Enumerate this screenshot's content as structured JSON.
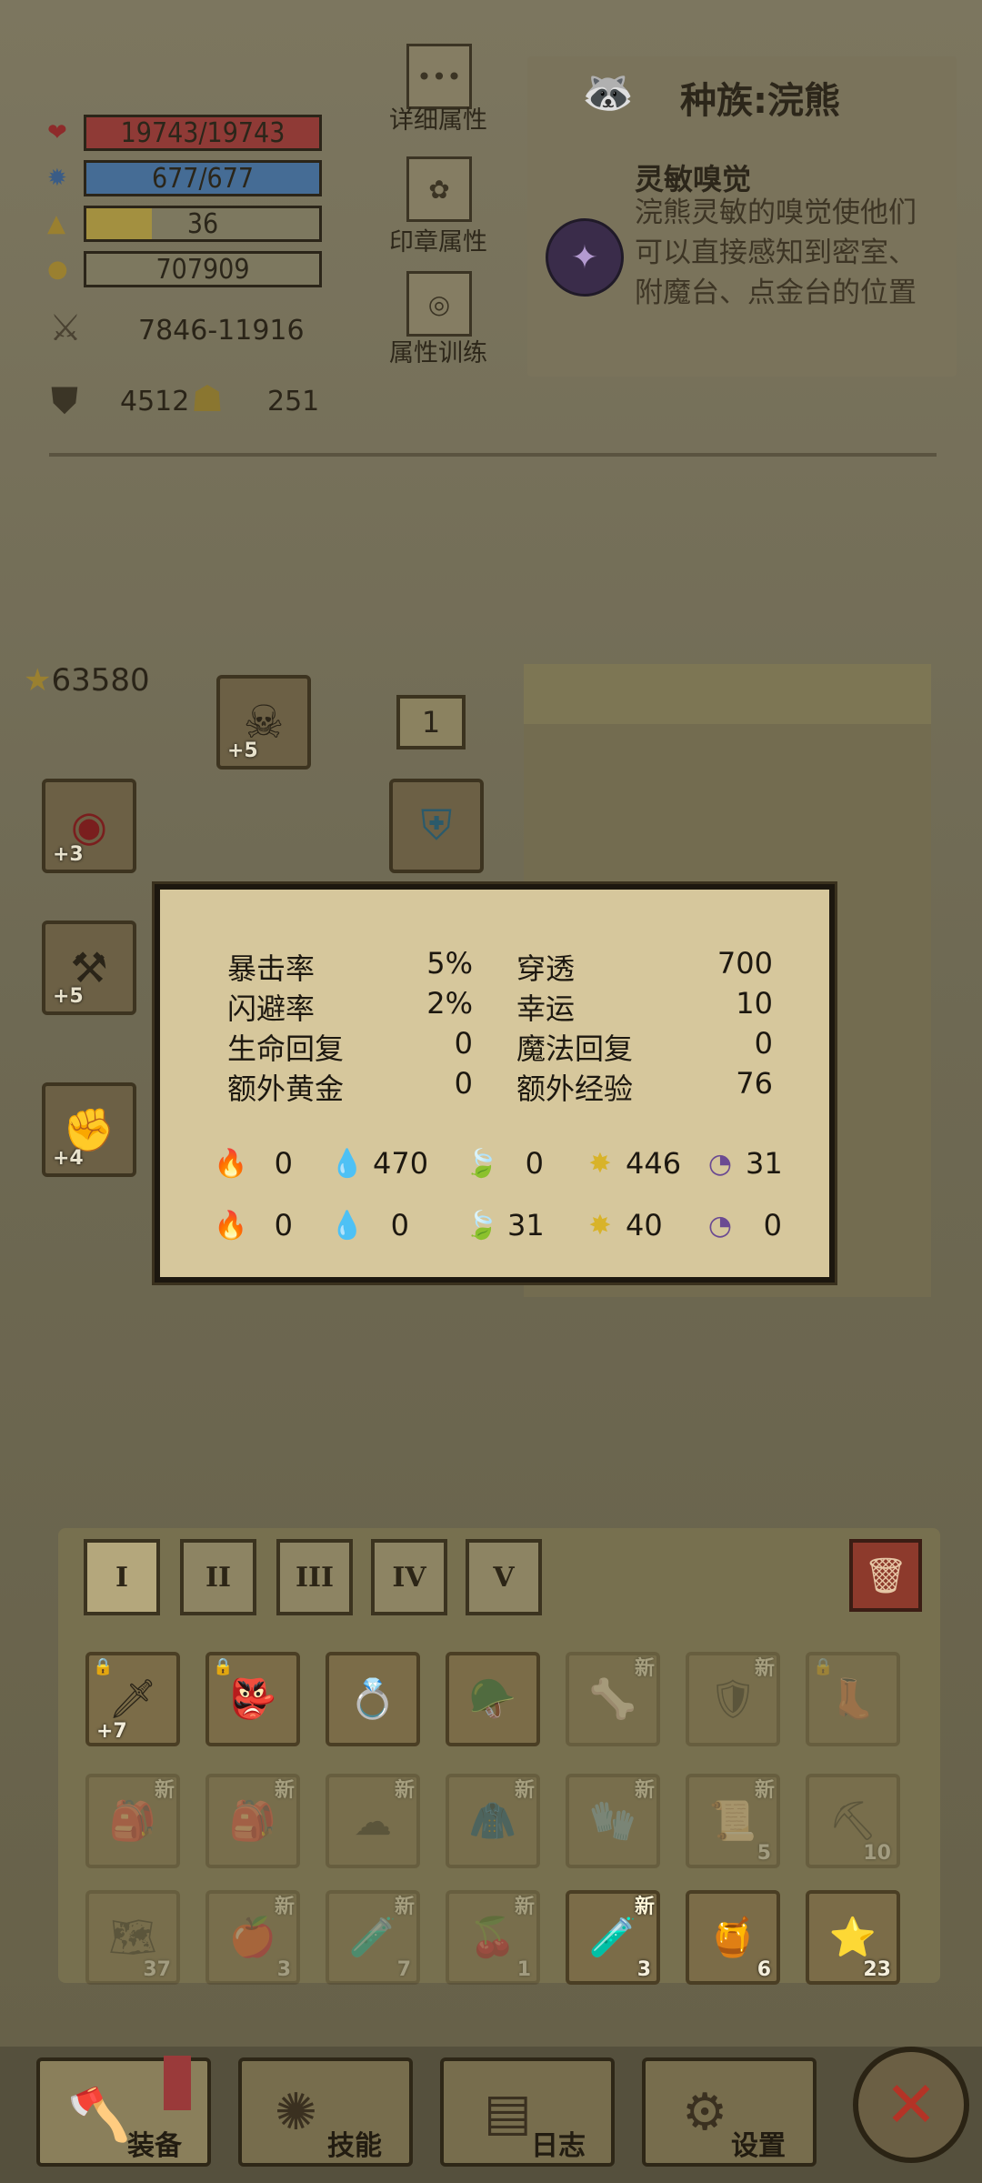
{
  "stats": {
    "hp": "19743/19743",
    "mp": "677/677",
    "level": "36",
    "gold": "707909",
    "attack": "7846-11916",
    "defense": "4512",
    "magic_def": "251"
  },
  "side_buttons": {
    "details": "详细属性",
    "seals": "印章属性",
    "training": "属性训练"
  },
  "race": {
    "title": "种族:浣熊",
    "trait_name": "灵敏嗅觉",
    "trait_desc": "浣熊灵敏的嗅觉使他们可以直接感知到密室、附魔台、点金台的位置"
  },
  "equipment": {
    "score": "63580",
    "slot_counter": "1",
    "slots": [
      {
        "plus": "+5"
      },
      {
        "plus": "+3"
      },
      {
        "plus": "+5"
      },
      {
        "plus": "+4"
      }
    ]
  },
  "popup": {
    "rows": [
      {
        "n1": "暴击率",
        "v1": "5%",
        "n2": "穿透",
        "v2": "700"
      },
      {
        "n1": "闪避率",
        "v1": "2%",
        "n2": "幸运",
        "v2": "10"
      },
      {
        "n1": "生命回复",
        "v1": "0",
        "n2": "魔法回复",
        "v2": "0"
      },
      {
        "n1": "额外黄金",
        "v1": "0",
        "n2": "额外经验",
        "v2": "76"
      }
    ],
    "elem_attack": [
      "0",
      "470",
      "0",
      "446",
      "31"
    ],
    "elem_resist": [
      "0",
      "0",
      "31",
      "40",
      "0"
    ],
    "colors": {
      "fire": "#c8382a",
      "water": "#3c83b8",
      "nature": "#5a8a3a",
      "light": "#d8b32a",
      "arcane": "#6b4a92"
    }
  },
  "inventory": {
    "tabs": [
      "I",
      "II",
      "III",
      "IV",
      "V"
    ],
    "new_badge": "新",
    "items": [
      {
        "plus": "+7",
        "count": "",
        "new": false
      },
      {
        "plus": "",
        "count": "",
        "new": false
      },
      {
        "plus": "",
        "count": "",
        "new": false
      },
      {
        "plus": "",
        "count": "",
        "new": false
      },
      {
        "plus": "",
        "count": "",
        "new": true
      },
      {
        "plus": "",
        "count": "",
        "new": true
      },
      {
        "plus": "",
        "count": "",
        "new": false
      },
      {
        "plus": "",
        "count": "",
        "new": true
      },
      {
        "plus": "",
        "count": "",
        "new": true
      },
      {
        "plus": "",
        "count": "",
        "new": true
      },
      {
        "plus": "",
        "count": "",
        "new": true
      },
      {
        "plus": "",
        "count": "",
        "new": true
      },
      {
        "plus": "",
        "count": "5",
        "new": true
      },
      {
        "plus": "",
        "count": "10",
        "new": false
      },
      {
        "plus": "",
        "count": "37",
        "new": false
      },
      {
        "plus": "",
        "count": "3",
        "new": true
      },
      {
        "plus": "",
        "count": "7",
        "new": true
      },
      {
        "plus": "",
        "count": "1",
        "new": true
      },
      {
        "plus": "",
        "count": "3",
        "new": true
      },
      {
        "plus": "",
        "count": "6",
        "new": false
      },
      {
        "plus": "",
        "count": "23",
        "new": false
      }
    ]
  },
  "nav": {
    "equip": "装备",
    "skills": "技能",
    "log": "日志",
    "settings": "设置"
  },
  "icons": [
    "heart-icon",
    "mana-icon",
    "level-icon",
    "gold-icon",
    "swords-icon",
    "shield-icon",
    "magic-shield-icon",
    "star-icon",
    "trash-icon",
    "close-icon"
  ]
}
